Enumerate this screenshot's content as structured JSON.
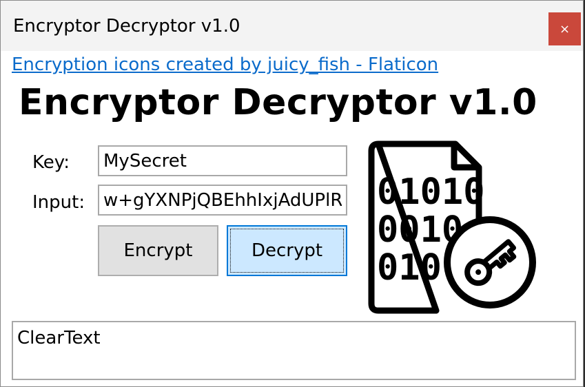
{
  "window": {
    "title": "Encryptor Decryptor v1.0",
    "close_glyph": "×"
  },
  "credit_link": "Encryption icons created by juicy_fish - Flaticon",
  "heading": "Encryptor Decryptor v1.0",
  "form": {
    "key_label": "Key:",
    "key_value": "MySecret",
    "input_label": "Input:",
    "input_value": "w+gYXNPjQBEhhIxjAdUPlR",
    "encrypt_label": "Encrypt",
    "decrypt_label": "Decrypt"
  },
  "output": {
    "value": "ClearText"
  },
  "icon": {
    "name": "encryption-file-key-icon",
    "rows": [
      "01010",
      "0010",
      "010"
    ]
  },
  "colors": {
    "close_bg": "#c42b1c",
    "link": "#0b6bcb",
    "decrypt_bg": "#cce8ff",
    "decrypt_border": "#0078d7"
  }
}
